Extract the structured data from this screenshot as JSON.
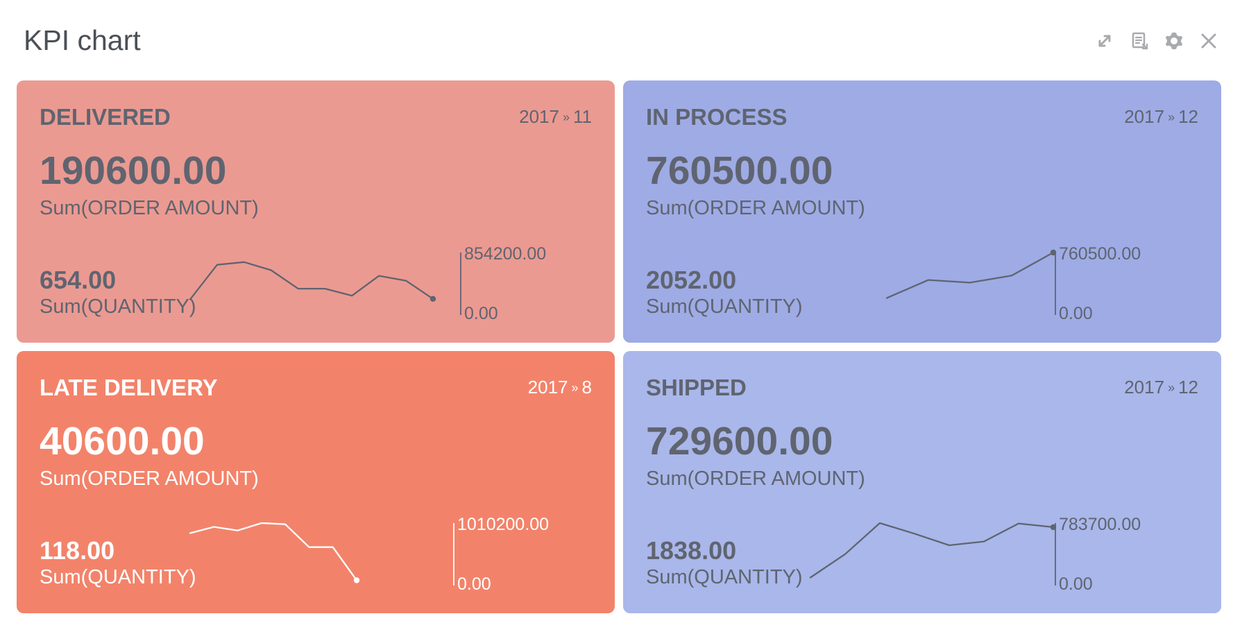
{
  "header": {
    "title": "KPI chart",
    "tools": [
      {
        "name": "expand-icon"
      },
      {
        "name": "export-icon"
      },
      {
        "name": "gear-icon"
      },
      {
        "name": "close-icon"
      }
    ]
  },
  "colors": {
    "delivered": "#eb9a91",
    "in_process": "#9eabe5",
    "late_delivery": "#f2836a",
    "shipped": "#a9b7ea",
    "dark_text": "#5f6470",
    "white_text": "#ffffff",
    "icon": "#a9aaad"
  },
  "cards": [
    {
      "status": "DELIVERED",
      "period_year": "2017",
      "period_separator": "»",
      "period_month": "11",
      "amount": "190600.00",
      "amount_label": "Sum(ORDER AMOUNT)",
      "quantity": "654.00",
      "quantity_label": "Sum(QUANTITY)"
    },
    {
      "status": "IN PROCESS",
      "period_year": "2017",
      "period_separator": "»",
      "period_month": "12",
      "amount": "760500.00",
      "amount_label": "Sum(ORDER AMOUNT)",
      "quantity": "2052.00",
      "quantity_label": "Sum(QUANTITY)"
    },
    {
      "status": "LATE DELIVERY",
      "period_year": "2017",
      "period_separator": "»",
      "period_month": "8",
      "amount": "40600.00",
      "amount_label": "Sum(ORDER AMOUNT)",
      "quantity": "118.00",
      "quantity_label": "Sum(QUANTITY)"
    },
    {
      "status": "SHIPPED",
      "period_year": "2017",
      "period_separator": "»",
      "period_month": "12",
      "amount": "729600.00",
      "amount_label": "Sum(ORDER AMOUNT)",
      "quantity": "1838.00",
      "quantity_label": "Sum(QUANTITY)"
    }
  ],
  "chart_data": [
    {
      "type": "line",
      "series": [
        {
          "values": [
            183000,
            678000,
            717000,
            601000,
            337000,
            337000,
            236000,
            520000,
            451000,
            190600
          ]
        }
      ],
      "ylim": [
        0,
        854200
      ],
      "y_ticks": [
        "854200.00",
        "0.00"
      ],
      "grid": false,
      "legend": "none",
      "style": {
        "line_color": "#5f6470",
        "axis_color": "#5f6470",
        "text_color": "#5f6470"
      }
    },
    {
      "type": "line",
      "series": [
        {
          "values": [
            180000,
            410000,
            377000,
            466000,
            760500
          ]
        }
      ],
      "ylim": [
        0,
        760500
      ],
      "y_ticks": [
        "760500.00",
        "0.00"
      ],
      "grid": false,
      "legend": "none",
      "style": {
        "line_color": "#5f6470",
        "axis_color": "#5f6470",
        "text_color": "#5f6470"
      }
    },
    {
      "type": "line",
      "series": [
        {
          "values": [
            840000,
            946000,
            885000,
            1010200,
            990000,
            603000,
            603000,
            40600
          ]
        }
      ],
      "ylim": [
        0,
        1010200
      ],
      "y_ticks": [
        "1010200.00",
        "0.00"
      ],
      "grid": false,
      "legend": "none",
      "style": {
        "line_color": "#ffffff",
        "axis_color": "#ffffff",
        "text_color": "#ffffff"
      }
    },
    {
      "type": "line",
      "series": [
        {
          "values": [
            68000,
            375000,
            783700,
            644000,
            492000,
            541000,
            778000,
            729600
          ]
        }
      ],
      "ylim": [
        0,
        783700
      ],
      "y_ticks": [
        "783700.00",
        "0.00"
      ],
      "grid": false,
      "legend": "none",
      "style": {
        "line_color": "#5f6470",
        "axis_color": "#5f6470",
        "text_color": "#5f6470"
      }
    }
  ]
}
